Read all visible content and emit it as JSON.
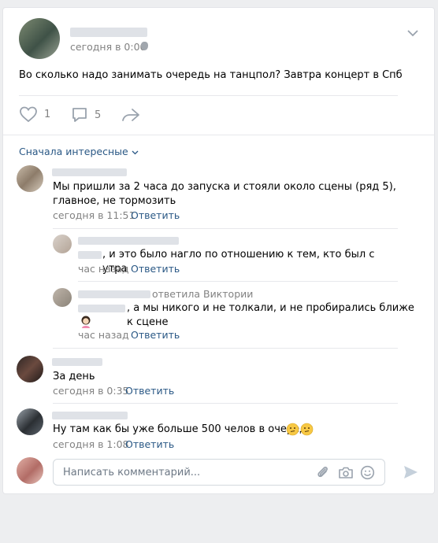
{
  "post": {
    "time": "сегодня в 0:00",
    "text": "Во сколько надо занимать очередь на танцпол? Завтра концерт в Спб",
    "likes": "1",
    "comments": "5"
  },
  "sort": {
    "label": "Сначала интересные"
  },
  "comments": [
    {
      "text": "Мы пришли за 2 часа до запуска и стояли около сцены (ряд 5), главное, не тормозить",
      "time": "сегодня в 11:51",
      "reply": "Ответить"
    },
    {
      "text": ", и это было нагло по отношению к тем, кто был с утра",
      "time": "час назад",
      "reply": "Ответить"
    },
    {
      "replied_to": "ответила Виктории",
      "text": ", а мы никого и не толкали, и не пробирались ближе к сцене",
      "time": "час назад",
      "reply": "Ответить"
    },
    {
      "text": "За день",
      "time": "сегодня в 0:35",
      "reply": "Ответить"
    },
    {
      "text": "Ну там как бы уже больше 500 челов в очереди",
      "time": "сегодня в 1:08",
      "reply": "Ответить"
    }
  ],
  "composer": {
    "placeholder": "Написать комментарий..."
  },
  "colors": {
    "link": "#2a5885",
    "meta": "#828282",
    "icon": "#99a2ad"
  }
}
